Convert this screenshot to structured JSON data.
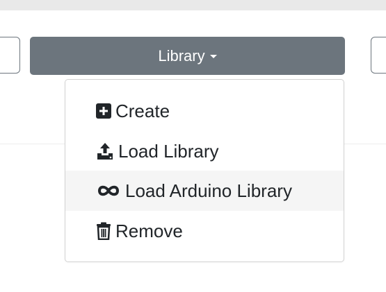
{
  "toolbar": {
    "library_button_label": "Library"
  },
  "dropdown": {
    "items": [
      {
        "label": "Create",
        "icon": "plus-square-icon"
      },
      {
        "label": "Load Library",
        "icon": "upload-icon"
      },
      {
        "label": "Load Arduino Library",
        "icon": "infinity-icon"
      },
      {
        "label": "Remove",
        "icon": "trash-icon"
      }
    ],
    "highlighted_item": "Load Arduino Library"
  },
  "colors": {
    "button_bg": "#6c757d",
    "button_text": "#ffffff",
    "menu_text": "#212529",
    "menu_hover_bg": "#f5f5f5"
  }
}
